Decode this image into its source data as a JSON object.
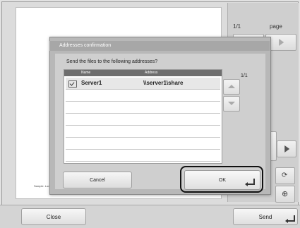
{
  "dialog": {
    "title": "Addresses confirmation",
    "prompt": "Send the files to the following addresses?",
    "list_counter": "1/1",
    "columns": {
      "name": "Name",
      "address": "Address"
    },
    "rows": [
      {
        "name": "Server1",
        "address": "\\\\server1\\share",
        "checked": true
      }
    ],
    "cancel_label": "Cancel",
    "ok_label": "OK"
  },
  "right_panel": {
    "page_counter": "1/1",
    "page_label": "page"
  },
  "preview": {
    "footer_text": "Sample. Lorem ipsum dolor sit amet, consectetur adipiscing elit, sed do eiusmod"
  },
  "bottom_bar": {
    "close_label": "Close",
    "send_label": "Send"
  }
}
